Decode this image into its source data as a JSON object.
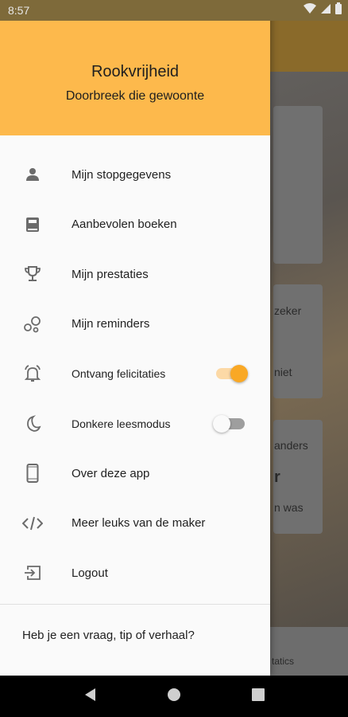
{
  "statusbar": {
    "time": "8:57"
  },
  "background": {
    "texts": [
      "zeker",
      "niet",
      "anders",
      "r",
      "n was",
      "tatics"
    ]
  },
  "drawer": {
    "title": "Rookvrijheid",
    "subtitle": "Doorbreek die gewoonte",
    "accent": "#fdb94c",
    "items": [
      {
        "icon": "person-icon",
        "label": "Mijn stopgegevens"
      },
      {
        "icon": "book-icon",
        "label": "Aanbevolen boeken"
      },
      {
        "icon": "trophy-icon",
        "label": "Mijn prestaties"
      },
      {
        "icon": "bubbles-icon",
        "label": "Mijn reminders"
      },
      {
        "icon": "alarm-icon",
        "label": "Ontvang felicitaties",
        "toggle": true
      },
      {
        "icon": "moon-icon",
        "label": "Donkere leesmodus",
        "toggle": false
      },
      {
        "icon": "phone-icon",
        "label": "Over deze app"
      },
      {
        "icon": "code-icon",
        "label": "Meer leuks van de maker"
      },
      {
        "icon": "logout-icon",
        "label": "Logout"
      }
    ],
    "footer": "Heb je een vraag, tip of verhaal?"
  },
  "navbar": {
    "icons": [
      "back-icon",
      "home-icon",
      "recents-icon"
    ]
  }
}
